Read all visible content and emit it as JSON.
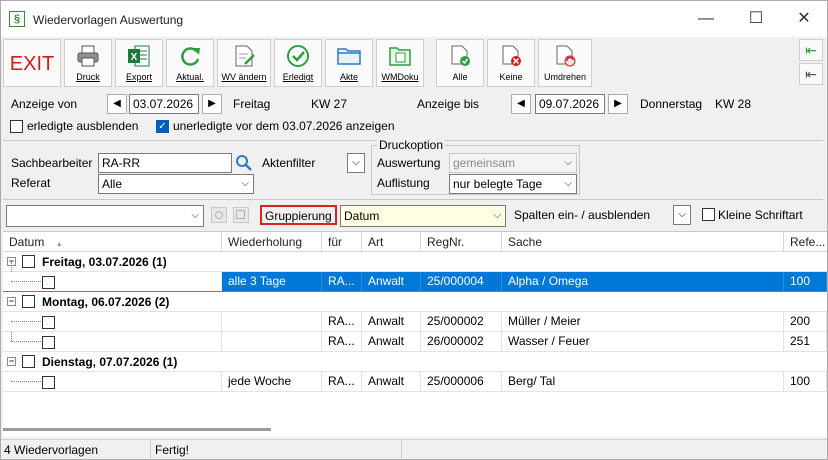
{
  "window": {
    "title": "Wiedervorlagen Auswertung",
    "icon_glyph": "§",
    "minimize_glyph": "—",
    "maximize_glyph": "☐",
    "close_glyph": "✕"
  },
  "toolbar": {
    "exit_label": "EXIT",
    "buttons": [
      {
        "label": "Druck",
        "icon": "printer-icon"
      },
      {
        "label": "Export",
        "icon": "excel-icon"
      },
      {
        "label": "Aktual.",
        "icon": "refresh-icon"
      },
      {
        "label": "WV ändern",
        "icon": "document-edit-icon"
      },
      {
        "label": "Erledigt",
        "icon": "checkmark-icon"
      },
      {
        "label": "Akte",
        "icon": "folder-icon"
      },
      {
        "label": "WMDoku",
        "icon": "document-folder-icon"
      },
      {
        "label": "Alle",
        "icon": "select-all-icon"
      },
      {
        "label": "Keine",
        "icon": "select-none-icon"
      },
      {
        "label": "Umdrehen",
        "icon": "invert-selection-icon"
      }
    ],
    "side_buttons": [
      {
        "glyph": "⇤",
        "icon": "collapse-left-icon"
      },
      {
        "glyph": "⇤",
        "icon": "expand-left-icon"
      }
    ]
  },
  "date_range": {
    "from_label": "Anzeige von",
    "from_date": "03.07.2026",
    "from_weekday": "Freitag",
    "from_week": "KW 27",
    "to_label": "Anzeige bis",
    "to_date": "09.07.2026",
    "to_weekday": "Donnerstag",
    "to_week": "KW 28",
    "prev_glyph": "◀",
    "next_glyph": "▶"
  },
  "options": {
    "hide_done_label": "erledigte ausblenden",
    "hide_done_checked": false,
    "show_open_label": "unerledigte vor dem 03.07.2026 anzeigen",
    "show_open_checked": true
  },
  "filters": {
    "sachbearbeiter_label": "Sachbearbeiter",
    "sachbearbeiter_value": "RA-RR",
    "referat_label": "Referat",
    "referat_value": "Alle",
    "aktenfilter_label": "Aktenfilter",
    "druckoption_label": "Druckoption",
    "auswertung_label": "Auswertung",
    "auswertung_value": "gemeinsam",
    "auflistung_label": "Auflistung",
    "auflistung_value": "nur belegte Tage"
  },
  "grouping": {
    "search_value": "",
    "gruppierung_label": "Gruppierung",
    "gruppierung_value": "Datum",
    "columns_label": "Spalten ein- / ausblenden",
    "small_font_label": "Kleine Schriftart",
    "small_font_checked": false
  },
  "grid": {
    "columns": [
      "Datum",
      "Wiederholung",
      "für",
      "Art",
      "RegNr.",
      "Sache",
      "Refe..."
    ],
    "sort_glyph": "▲",
    "groups": [
      {
        "title": "Freitag, 03.07.2026 (1)",
        "rows": [
          {
            "wiederholung": "alle 3 Tage",
            "fuer": "RA...",
            "art": "Anwalt",
            "regnr": "25/000004",
            "sache": "Alpha / Omega",
            "ref": "100",
            "selected": true
          }
        ]
      },
      {
        "title": "Montag, 06.07.2026 (2)",
        "rows": [
          {
            "wiederholung": "",
            "fuer": "RA...",
            "art": "Anwalt",
            "regnr": "25/000002",
            "sache": "Müller / Meier",
            "ref": "200",
            "selected": false
          },
          {
            "wiederholung": "",
            "fuer": "RA...",
            "art": "Anwalt",
            "regnr": "26/000002",
            "sache": "Wasser / Feuer",
            "ref": "251",
            "selected": false
          }
        ]
      },
      {
        "title": "Dienstag, 07.07.2026 (1)",
        "rows": [
          {
            "wiederholung": "jede Woche",
            "fuer": "RA...",
            "art": "Anwalt",
            "regnr": "25/000006",
            "sache": "Berg/ Tal",
            "ref": "100",
            "selected": false
          }
        ]
      }
    ]
  },
  "status": {
    "count": "4 Wiedervorlagen",
    "state": "Fertig!"
  },
  "colors": {
    "exit_red": "#d21b1b",
    "selection_blue": "#0078d7",
    "highlight_border": "#e0201f",
    "combo_yellow": "#ffffe1",
    "excel_green": "#1d7a3c",
    "check_green": "#2e9e3e"
  }
}
